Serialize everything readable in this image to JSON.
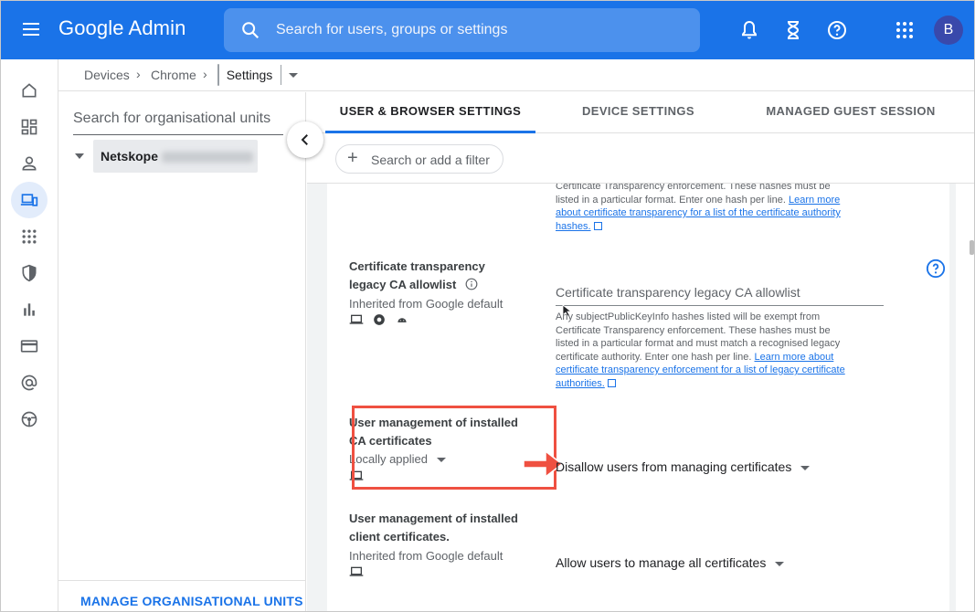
{
  "header": {
    "brand": "Google Admin",
    "search_placeholder": "Search for users, groups or settings",
    "avatar_letter": "B",
    "accent": "#1a73e8"
  },
  "rail": {
    "items": [
      "home-icon",
      "dashboard-icon",
      "person-icon",
      "devices-icon",
      "apps-icon",
      "security-icon",
      "reports-icon",
      "billing-icon",
      "account-icon",
      "rules-icon"
    ],
    "active": "devices-icon"
  },
  "breadcrumb": {
    "items": [
      "Devices",
      "Chrome"
    ],
    "current": "Settings"
  },
  "org": {
    "search_placeholder": "Search for organisational units",
    "node_name": "Netskope",
    "manage_label": "MANAGE ORGANISATIONAL UNITS"
  },
  "tabs": [
    "USER & BROWSER SETTINGS",
    "DEVICE SETTINGS",
    "MANAGED GUEST SESSION SETTINGS"
  ],
  "filter": {
    "label": "Search or add a filter"
  },
  "settings": {
    "top_help": {
      "line1": "Certificate Transparency enforcement. These hashes must be",
      "line2": "listed in a particular format. Enter one hash per line.",
      "link1": "Learn more",
      "link2": "about certificate transparency for a list of the certificate authority",
      "link3": "hashes."
    },
    "legacy": {
      "name_line1": "Certificate transparency",
      "name_line2": "legacy CA allowlist",
      "source": "Inherited from Google default",
      "field_placeholder": "Certificate transparency legacy CA allowlist",
      "help_line1": "Any subjectPublicKeyInfo hashes listed will be exempt from",
      "help_line2": "Certificate Transparency enforcement. These hashes must be",
      "help_line3": "listed in a particular format and must match a recognised legacy",
      "help_line4": "certificate authority. Enter one hash per line.",
      "help_link1": "Learn more about",
      "help_link2": "certificate transparency enforcement for a list of legacy certificate",
      "help_link3": "authorities."
    },
    "ca_mgmt": {
      "name_line1": "User management of installed",
      "name_line2": "CA certificates",
      "source": "Locally applied",
      "value": "Disallow users from managing certificates",
      "highlight_color": "#ef5041"
    },
    "client_mgmt": {
      "name_line1": "User management of installed",
      "name_line2": "client certificates.",
      "source": "Inherited from Google default",
      "value": "Allow users to manage all certificates"
    }
  }
}
